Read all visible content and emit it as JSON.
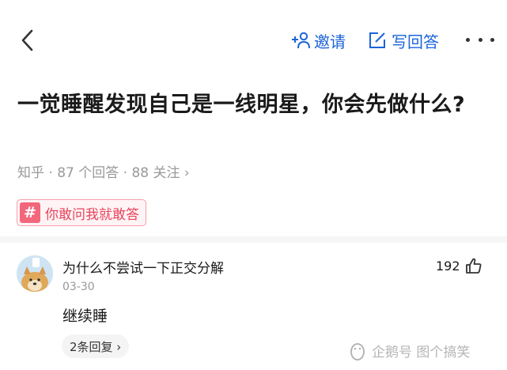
{
  "header": {
    "invite_label": "邀请",
    "write_answer_label": "写回答"
  },
  "question": {
    "title": "一觉睡醒发现自己是一线明星，你会先做什么?",
    "meta": "知乎 · 87 个回答 · 88 关注 ›",
    "topic": "你敢问我就敢答",
    "topic_icon": "#"
  },
  "comment": {
    "username": "为什么不尝试一下正交分解",
    "date": "03-30",
    "text": "继续睡",
    "likes": "192",
    "replies_label": "2条回复 ›"
  },
  "watermark": "企鹅号 图个搞笑",
  "colors": {
    "accent_blue": "#1b64d9",
    "topic_pink": "#e8445c",
    "meta_gray": "#999999"
  }
}
